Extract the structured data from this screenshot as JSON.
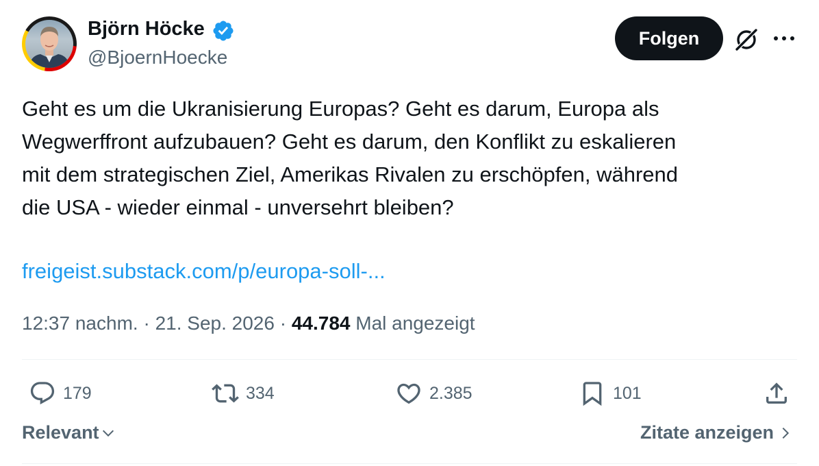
{
  "author": {
    "display_name": "Björn Höcke",
    "handle": "@BjoernHoecke",
    "verified_icon": "verified-badge-icon",
    "verified_color": "#1d9bf0"
  },
  "header": {
    "follow_label": "Folgen",
    "grok_icon": "grok-icon",
    "more_icon": "more-dots-icon"
  },
  "tweet": {
    "lines": [
      "Geht es um die Ukranisierung Europas? Geht es darum, Europa als",
      "Wegwerffront aufzubauen? Geht es darum, den Konflikt zu eskalieren",
      "mit dem strategischen Ziel, Amerikas Rivalen zu erschöpfen, während",
      "die USA - wieder einmal - unversehrt bleiben?"
    ],
    "link": "freigeist.substack.com/p/europa-soll-..."
  },
  "meta": {
    "time": "12:37 nachm.",
    "sep": " · ",
    "date": "21. Sep. 2026",
    "views": "44.784",
    "views_label": " Mal angezeigt"
  },
  "actions": {
    "replies": "179",
    "reposts": "334",
    "likes": "2.385",
    "bookmarks": "101"
  },
  "footer": {
    "sort_label": "Relevant",
    "quotes_label": "Zitate anzeigen"
  },
  "colors": {
    "text": "#0f1419",
    "secondary": "#536471",
    "link": "#1d9bf0",
    "follow_bg": "#0f1419"
  }
}
